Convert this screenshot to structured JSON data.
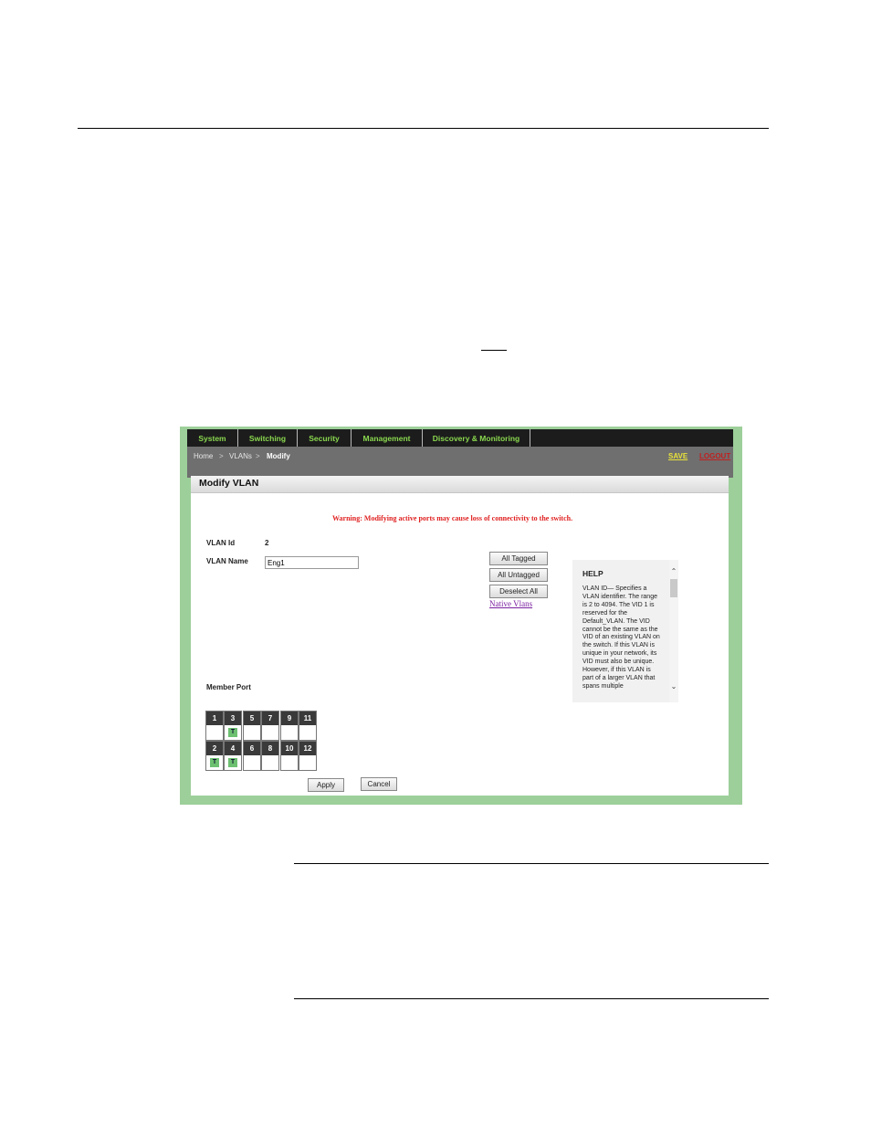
{
  "screenshot": {
    "nav": [
      "System",
      "Switching",
      "Security",
      "Management",
      "Discovery & Monitoring"
    ],
    "breadcrumb": {
      "home": "Home",
      "sep": ">",
      "vlans": "VLANs",
      "current": "Modify"
    },
    "save_link": "SAVE",
    "logout_link": "LOGOUT",
    "panel_title": "Modify VLAN",
    "warning": "Warning: Modifying active ports may cause loss of connectivity to the switch.",
    "vlan_id_label": "VLAN Id",
    "vlan_id_value": "2",
    "vlan_name_label": "VLAN Name",
    "vlan_name_value": "Eng1",
    "buttons": {
      "all_tagged": "All Tagged",
      "all_untagged": "All Untagged",
      "deselect_all": "Deselect All",
      "apply": "Apply",
      "cancel": "Cancel"
    },
    "native_vlans_link": "Native Vlans",
    "help": {
      "title": "HELP",
      "text": "VLAN ID— Specifies a VLAN identifier. The range is 2 to 4094. The VID 1 is reserved for the Default_VLAN. The VID cannot be the same as the VID of an existing VLAN on the switch. If this VLAN is unique in your network, its VID must also be unique. However, if this VLAN is part of a larger VLAN that spans multiple"
    },
    "member_port_label": "Member Port",
    "ports_top": [
      {
        "num": "1",
        "tag": ""
      },
      {
        "num": "3",
        "tag": "T"
      },
      {
        "num": "5",
        "tag": ""
      },
      {
        "num": "7",
        "tag": ""
      },
      {
        "num": "9",
        "tag": ""
      },
      {
        "num": "11",
        "tag": ""
      }
    ],
    "ports_bottom": [
      {
        "num": "2",
        "tag": "T"
      },
      {
        "num": "4",
        "tag": "T"
      },
      {
        "num": "6",
        "tag": ""
      },
      {
        "num": "8",
        "tag": ""
      },
      {
        "num": "10",
        "tag": ""
      },
      {
        "num": "12",
        "tag": ""
      }
    ],
    "colors": {
      "nav_text": "#8ad84f",
      "warning": "#e02020",
      "save": "#e8e23a",
      "logout": "#c02020",
      "tag": "#6cc070",
      "frame": "#9dcf9a"
    }
  }
}
